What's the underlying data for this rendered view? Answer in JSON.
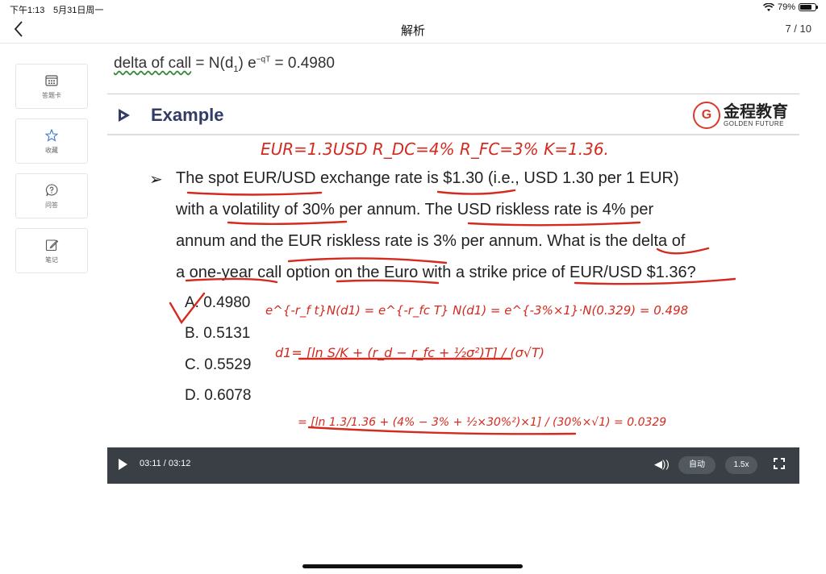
{
  "status_bar": {
    "time": "下午1:13",
    "date": "5月31日周一",
    "battery": "79%",
    "battery_level": 0.79
  },
  "navbar": {
    "title": "解析",
    "page": "7 / 10"
  },
  "tools": [
    {
      "label": "答题卡",
      "icon": "answer-card-icon"
    },
    {
      "label": "收藏",
      "icon": "star-icon"
    },
    {
      "label": "问答",
      "icon": "question-icon"
    },
    {
      "label": "笔记",
      "icon": "note-edit-icon"
    }
  ],
  "slide": {
    "top_formula": {
      "a": "delta of call",
      "b": " = N(d",
      "sub": "1",
      "c": ") e",
      "sup": "−qT",
      "d": " = 0.4980"
    },
    "section_title": "Example",
    "logo": {
      "cn": "金程教育",
      "en": "GOLDEN FUTURE"
    },
    "question_lines": [
      "The spot EUR/USD exchange rate is $1.30 (i.e., USD 1.30 per 1 EUR)",
      "with a volatility of 30% per annum. The USD riskless rate is 4% per",
      "annum and the EUR riskless rate is 3% per annum. What is the delta of",
      "a one-year call option on the Euro with a strike price of EUR/USD $1.36?"
    ],
    "bullet": "➢",
    "options": [
      "A. 0.4980",
      "B. 0.5131",
      "C. 0.5529",
      "D. 0.6078"
    ],
    "handwriting": {
      "line1": "EUR=1.3USD   R_DC=4%   R_FC=3%   K=1.36.",
      "formula": "e^{-r_f t}N(d1) = e^{-r_fc T} N(d1) = e^{-3%×1}·N(0.329) = 0.498",
      "d1": "d1= [ln S/K + (r_d − r_fc + ½σ²)T] / (σ√T)",
      "calc": "= [ln 1.3/1.36 + (4% − 3% + ½×30%²)×1] / (30%×√1) = 0.0329"
    }
  },
  "player": {
    "time": "03:11 / 03:12",
    "auto": "自动",
    "speed": "1.5x"
  },
  "colors": {
    "ink": "#d42a1f",
    "player_bg": "#3a3f45",
    "title": "#333c66"
  }
}
